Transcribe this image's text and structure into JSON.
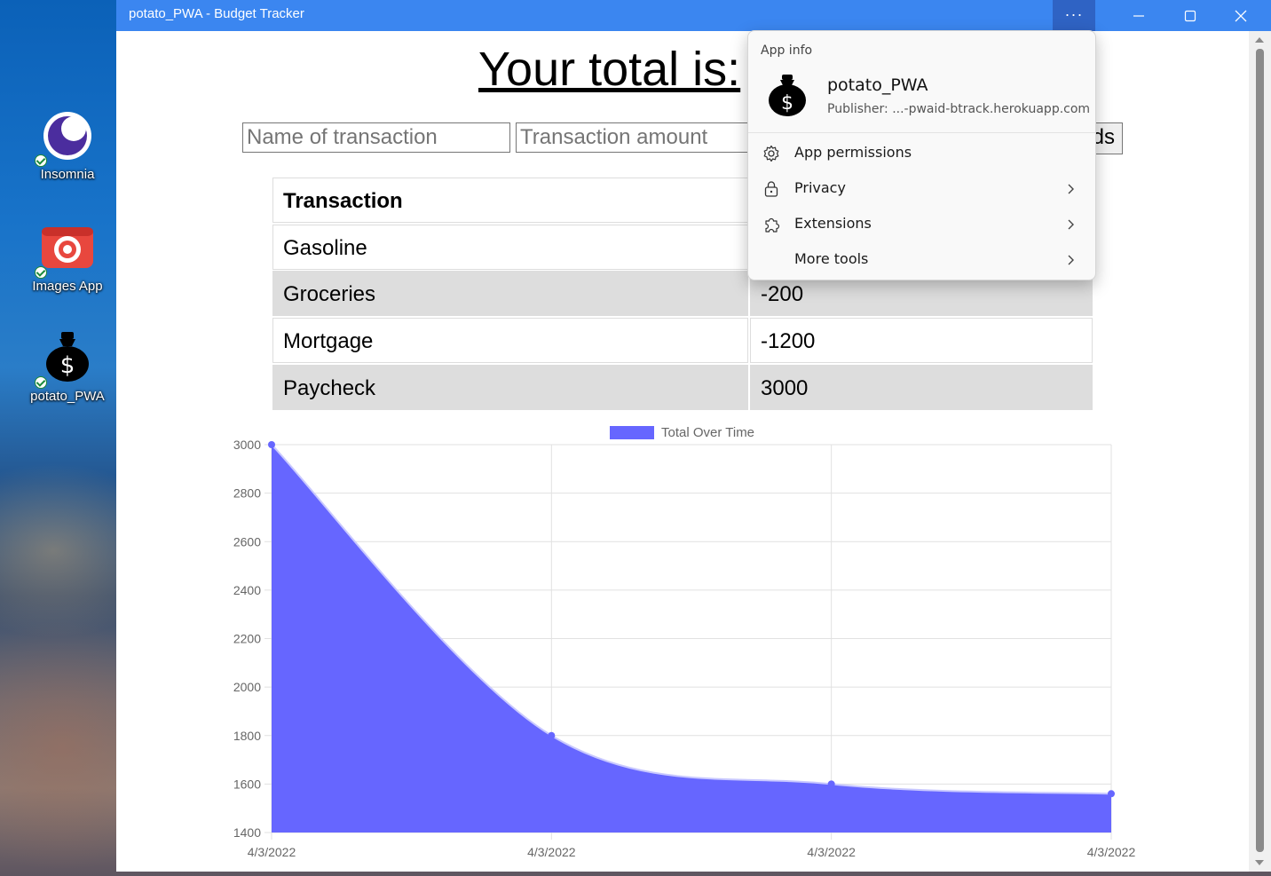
{
  "window": {
    "title": "potato_PWA - Budget Tracker",
    "menu_label": "···"
  },
  "desktop_icons": [
    {
      "label": "Insomnia",
      "icon": "insomnia-app-icon"
    },
    {
      "label": "Images App",
      "icon": "camera-app-icon"
    },
    {
      "label": "potato_PWA",
      "icon": "money-bag-icon"
    }
  ],
  "page": {
    "total_label": "Your total is:",
    "name_placeholder": "Name of transaction",
    "amount_placeholder": "Transaction amount",
    "add_button_visible": "ds"
  },
  "table": {
    "header": "Transaction",
    "rows": [
      {
        "name": "Gasoline",
        "amount": ""
      },
      {
        "name": "Groceries",
        "amount": "-200"
      },
      {
        "name": "Mortgage",
        "amount": "-1200"
      },
      {
        "name": "Paycheck",
        "amount": "3000"
      }
    ]
  },
  "popup": {
    "heading": "App info",
    "app_name": "potato_PWA",
    "publisher": "Publisher: ...-pwaid-btrack.herokuapp.com",
    "items": [
      {
        "label": "App permissions",
        "icon": "gear-icon",
        "chevron": false
      },
      {
        "label": "Privacy",
        "icon": "lock-icon",
        "chevron": true
      },
      {
        "label": "Extensions",
        "icon": "puzzle-icon",
        "chevron": true
      },
      {
        "label": "More tools",
        "icon": "",
        "chevron": true
      }
    ]
  },
  "colors": {
    "accent": "#3b86f0",
    "series": "#6666ff"
  },
  "chart_data": {
    "type": "area",
    "legend": "Total Over Time",
    "x": [
      "4/3/2022",
      "4/3/2022",
      "4/3/2022",
      "4/3/2022"
    ],
    "series": [
      {
        "name": "Total Over Time",
        "values": [
          3000,
          1800,
          1600,
          1560
        ]
      }
    ],
    "ylim": [
      1400,
      3000
    ],
    "yticks": [
      3000,
      2800,
      2600,
      2400,
      2200,
      2000,
      1800,
      1600,
      1400
    ],
    "grid": true,
    "legend_position": "top"
  }
}
